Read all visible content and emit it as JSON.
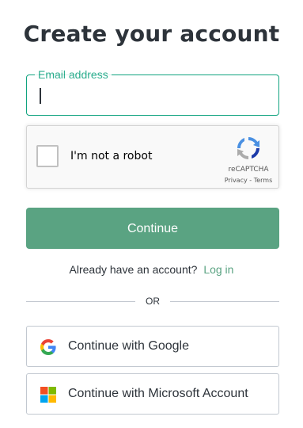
{
  "page": {
    "title": "Create your account"
  },
  "email": {
    "label": "Email address",
    "value": "",
    "accent_color": "#10a37f"
  },
  "recaptcha": {
    "checkbox_label": "I'm not a robot",
    "brand": "reCAPTCHA",
    "links": "Privacy - Terms",
    "checked": false
  },
  "continue_button": {
    "label": "Continue",
    "color": "#5aa382"
  },
  "login_prompt": {
    "text": "Already have an account?",
    "link": "Log in"
  },
  "divider": {
    "text": "OR"
  },
  "social": {
    "google": {
      "label": "Continue with Google",
      "icon": "google-icon"
    },
    "microsoft": {
      "label": "Continue with Microsoft Account",
      "icon": "microsoft-icon"
    }
  }
}
